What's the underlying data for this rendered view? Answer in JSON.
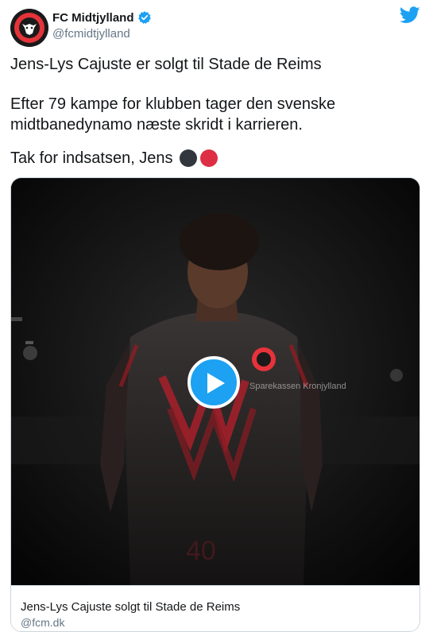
{
  "author": {
    "display_name": "FC Midtjylland",
    "handle": "@fcmidtjylland",
    "verified": true,
    "avatar_icon": "fc-midtjylland-crest"
  },
  "tweet": {
    "line1": "Jens-Lys Cajuste er solgt til Stade de Reims",
    "line2": "Efter 79 kampe for klubben tager den svenske midtbanedynamo næste skridt i karrieren.",
    "line3": "Tak for indsatsen, Jens",
    "emojis": [
      "black-circle",
      "red-circle"
    ]
  },
  "card": {
    "title": "Jens-Lys Cajuste solgt til Stade de Reims",
    "domain": "@fcm.dk",
    "media_icon": "play-icon",
    "shirt_number": "40",
    "sponsor_text": "Sparekassen Kronjylland"
  },
  "colors": {
    "twitter_blue": "#1da1f2",
    "verified_blue": "#1da1f2",
    "club_red": "#e5333a",
    "text": "#14171a",
    "secondary": "#657786"
  }
}
